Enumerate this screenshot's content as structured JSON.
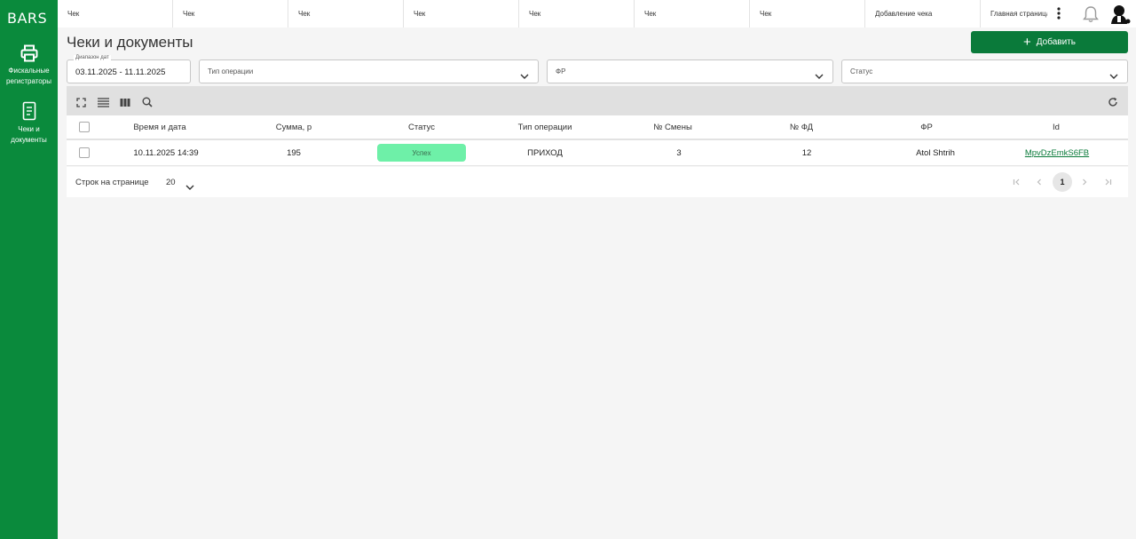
{
  "sidebar": {
    "brand": "BARS",
    "items": [
      {
        "label": "Фискальные регистраторы",
        "icon": "printer-icon"
      },
      {
        "label": "Чеки и документы",
        "icon": "document-icon"
      }
    ],
    "background": "#0a8a3c"
  },
  "topbar": {
    "tabs": [
      "Чек",
      "Чек",
      "Чек",
      "Чек",
      "Чек",
      "Чек",
      "Чек",
      "Добавление чека",
      "Главная страница"
    ],
    "more_icon": "more-vertical-icon",
    "bell_icon": "bell-icon",
    "avatar_icon": "user-avatar-icon"
  },
  "page": {
    "title": "Чеки и документы",
    "add_button": "Добавить"
  },
  "filters": {
    "date_range": {
      "legend": "Диапазон дат",
      "value": "03.11.2025 - 11.11.2025"
    },
    "operation_type": {
      "placeholder": "Тип операции"
    },
    "fr": {
      "placeholder": "ФР"
    },
    "status": {
      "placeholder": "Статус"
    }
  },
  "toolbar": {
    "icons": [
      "fullscreen-icon",
      "density-icon",
      "columns-icon",
      "search-icon",
      "refresh-icon"
    ]
  },
  "table": {
    "columns": [
      "Время и дата",
      "Сумма, р",
      "Статус",
      "Тип операции",
      "№ Смены",
      "№ ФД",
      "ФР",
      "Id"
    ],
    "rows": [
      {
        "datetime": "10.11.2025 14:39",
        "sum": "195",
        "status": "Успех",
        "op_type": "ПРИХОД",
        "shift": "3",
        "fd": "12",
        "fr": "Atol Shtrih",
        "id": "MpvDzEmkS6FB"
      }
    ]
  },
  "pagination": {
    "rows_label": "Строк на странице",
    "rows_value": "20",
    "current_page": "1"
  },
  "colors": {
    "accent": "#0a7a3a",
    "success_badge": "#6ef0a8"
  }
}
